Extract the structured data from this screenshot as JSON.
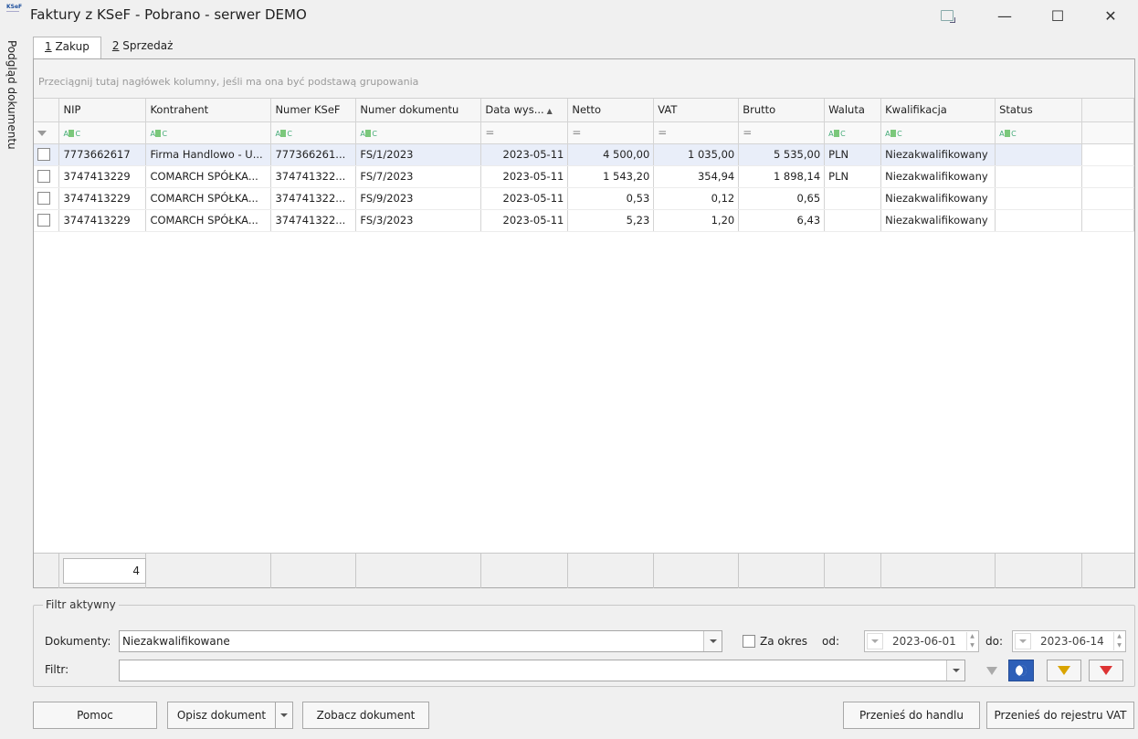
{
  "window": {
    "logo_text": "KSeF",
    "title": "Faktury z KSeF - Pobrano - serwer DEMO",
    "minimize_glyph": "—",
    "maximize_glyph": "☐",
    "close_glyph": "✕"
  },
  "side_tab": {
    "label": "Podgląd dokumentu"
  },
  "tabs": [
    {
      "hotkey": "1",
      "label": " Zakup",
      "active": true
    },
    {
      "hotkey": "2",
      "label": " Sprzedaż",
      "active": false
    }
  ],
  "grid": {
    "group_hint": "Przeciągnij tutaj nagłówek kolumny, jeśli ma ona być podstawą grupowania",
    "columns": [
      "",
      "NIP",
      "Kontrahent",
      "Numer KSeF",
      "Numer dokumentu",
      "Data wys...",
      "Netto",
      "VAT",
      "Brutto",
      "Waluta",
      "Kwalifikacja",
      "Status"
    ],
    "rows": [
      {
        "nip": "7773662617",
        "kontrahent": "Firma Handlowo - U...",
        "numer_ksef": "777366261...",
        "numer_dok": "FS/1/2023",
        "data": "2023-05-11",
        "netto": "4 500,00",
        "vat": "1 035,00",
        "brutto": "5 535,00",
        "waluta": "PLN",
        "kwalifikacja": "Niezakwalifikowany",
        "status": ""
      },
      {
        "nip": "3747413229",
        "kontrahent": "COMARCH SPÓŁKA...",
        "numer_ksef": "374741322...",
        "numer_dok": "FS/7/2023",
        "data": "2023-05-11",
        "netto": "1 543,20",
        "vat": "354,94",
        "brutto": "1 898,14",
        "waluta": "PLN",
        "kwalifikacja": "Niezakwalifikowany",
        "status": ""
      },
      {
        "nip": "3747413229",
        "kontrahent": "COMARCH SPÓŁKA...",
        "numer_ksef": "374741322...",
        "numer_dok": "FS/9/2023",
        "data": "2023-05-11",
        "netto": "0,53",
        "vat": "0,12",
        "brutto": "0,65",
        "waluta": "",
        "kwalifikacja": "Niezakwalifikowany",
        "status": ""
      },
      {
        "nip": "3747413229",
        "kontrahent": "COMARCH SPÓŁKA...",
        "numer_ksef": "374741322...",
        "numer_dok": "FS/3/2023",
        "data": "2023-05-11",
        "netto": "5,23",
        "vat": "1,20",
        "brutto": "6,43",
        "waluta": "",
        "kwalifikacja": "Niezakwalifikowany",
        "status": ""
      }
    ],
    "row_count": "4",
    "filter_row_text_glyph": "ABC",
    "filter_row_num_glyph": "="
  },
  "filter": {
    "legend": "Filtr aktywny",
    "dokumenty_label": "Dokumenty:",
    "dokumenty_value": "Niezakwalifikowane",
    "za_okres_label": "Za okres",
    "od_label": "od:",
    "od_value": "2023-06-01",
    "do_label": "do:",
    "do_value": "2023-06-14",
    "filtr_label": "Filtr:",
    "filtr_value": ""
  },
  "buttons": {
    "pomoc": "Pomoc",
    "opisz": "Opisz dokument",
    "zobacz": "Zobacz dokument",
    "przenies_handel": "Przenieś do handlu",
    "przenies_vat": "Przenieś do rejestru VAT"
  },
  "colors": {
    "selected_row": "#e9eef9",
    "accent_blue": "#2d5fb8"
  }
}
